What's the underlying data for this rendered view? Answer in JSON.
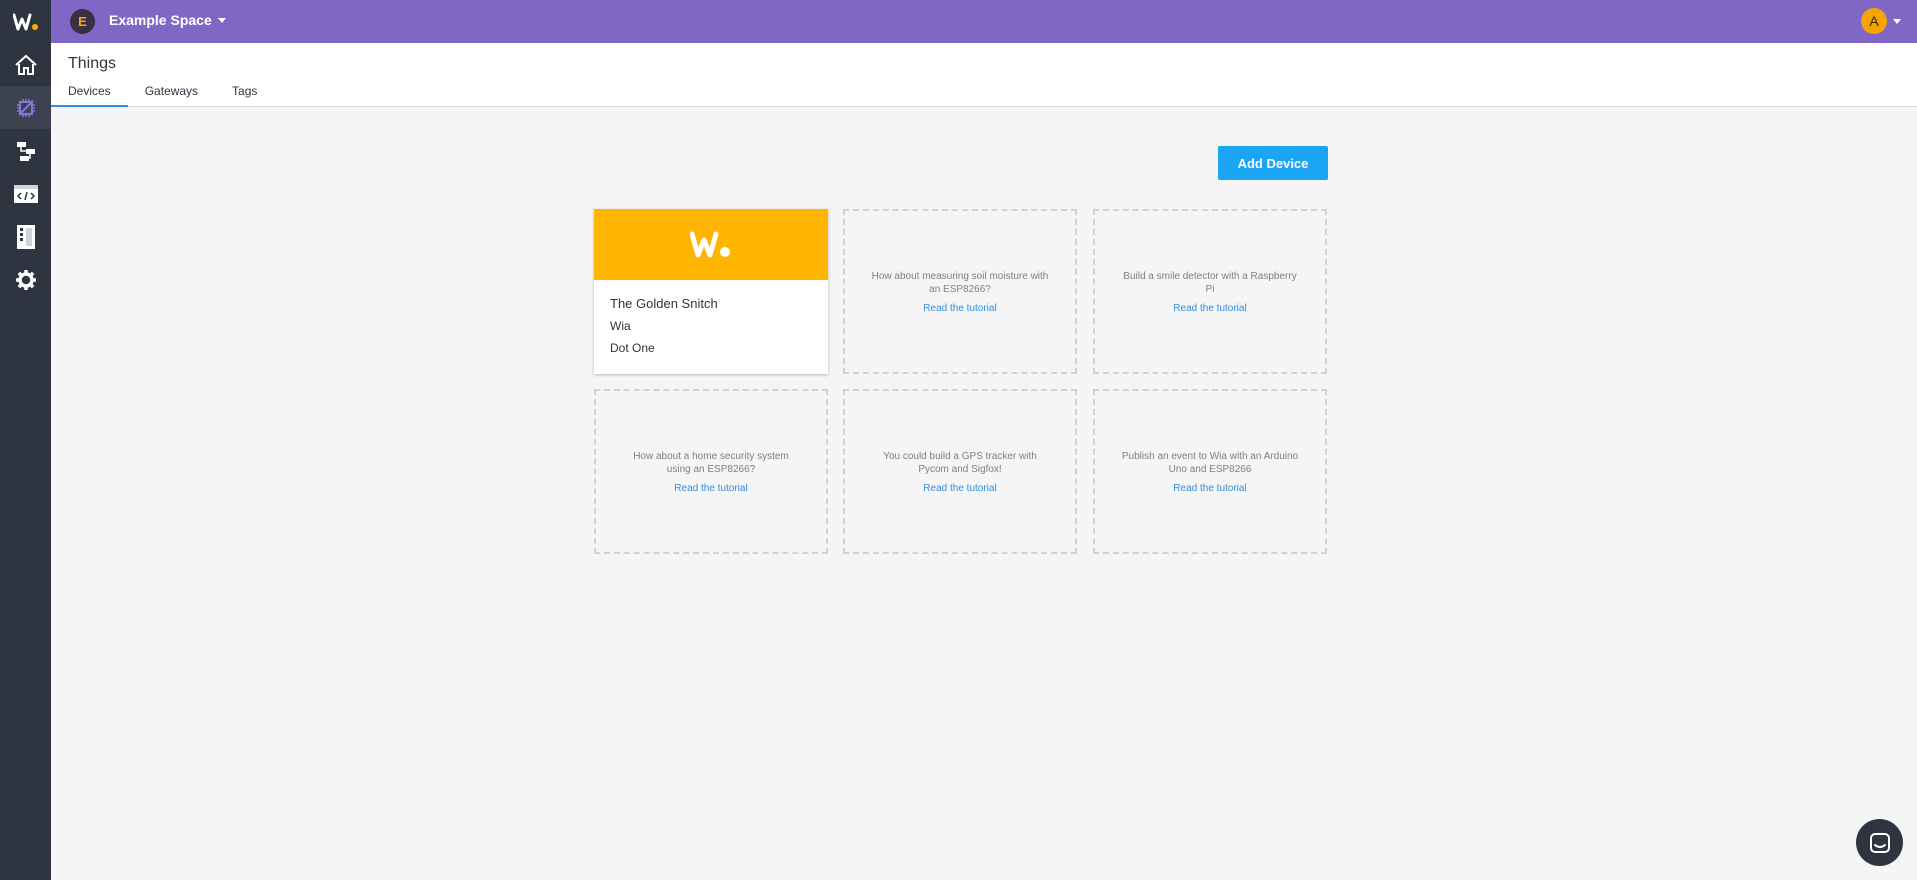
{
  "topbar": {
    "space_initial": "E",
    "space_name": "Example Space",
    "user_initial": "A"
  },
  "header": {
    "title": "Things",
    "tabs": [
      {
        "label": "Devices",
        "active": true
      },
      {
        "label": "Gateways",
        "active": false
      },
      {
        "label": "Tags",
        "active": false
      }
    ]
  },
  "sidebar": {
    "items": [
      {
        "icon": "home-icon"
      },
      {
        "icon": "things-icon",
        "active": true
      },
      {
        "icon": "flows-icon"
      },
      {
        "icon": "code-icon"
      },
      {
        "icon": "dashboards-icon"
      },
      {
        "icon": "gear-icon"
      }
    ]
  },
  "main": {
    "add_button_label": "Add Device",
    "device": {
      "name": "The Golden Snitch",
      "line1": "Wia",
      "line2": "Dot One"
    },
    "ideas": [
      {
        "text": "How about measuring soil moisture with an ESP8266?",
        "link": "Read the tutorial"
      },
      {
        "text": "Build a smile detector with a Raspberry Pi",
        "link": "Read the tutorial"
      },
      {
        "text": "How about a home security system using an ESP8266?",
        "link": "Read the tutorial"
      },
      {
        "text": "You could build a GPS tracker with Pycom and Sigfox!",
        "link": "Read the tutorial"
      },
      {
        "text": "Publish an event to Wia with an Arduino Uno and ESP8266",
        "link": "Read the tutorial"
      }
    ]
  },
  "colors": {
    "topbar": "#8067c6",
    "sidebar": "#2e3440",
    "accent": "#1aa5f5",
    "device_banner": "#ffb400"
  }
}
